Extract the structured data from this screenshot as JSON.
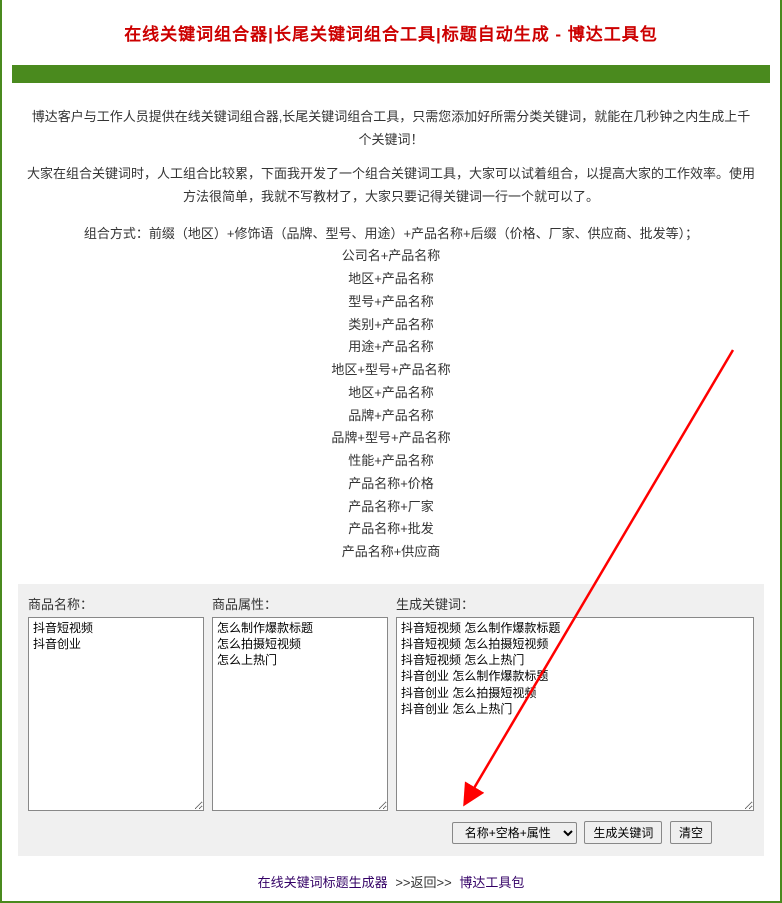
{
  "title": "在线关键词组合器|长尾关键词组合工具|标题自动生成 - 博达工具包",
  "intro": {
    "p1": "博达客户与工作人员提供在线关键词组合器,长尾关键词组合工具，只需您添加好所需分类关键词，就能在几秒钟之内生成上千个关键词！",
    "p2": "大家在组合关键词时，人工组合比较累，下面我开发了一个组合关键词工具，大家可以试着组合，以提高大家的工作效率。使用方法很简单，我就不写教材了，大家只要记得关键词一行一个就可以了。"
  },
  "combo": {
    "head": "组合方式：前缀（地区）+修饰语（品牌、型号、用途）+产品名称+后缀（价格、厂家、供应商、批发等）；",
    "items": [
      "公司名+产品名称",
      "地区+产品名称",
      "型号+产品名称",
      "类别+产品名称",
      "用途+产品名称",
      "地区+型号+产品名称",
      "地区+产品名称",
      "品牌+产品名称",
      "品牌+型号+产品名称",
      "性能+产品名称",
      "产品名称+价格",
      "产品名称+厂家",
      "产品名称+批发",
      "产品名称+供应商"
    ]
  },
  "form": {
    "label_name": "商品名称：",
    "label_attr": "商品属性：",
    "label_result": "生成关键词：",
    "name_value": "抖音短视频\n抖音创业",
    "attr_value": "怎么制作爆款标题\n怎么拍摄短视频\n怎么上热门",
    "result_value": "抖音短视频 怎么制作爆款标题\n抖音短视频 怎么拍摄短视频\n抖音短视频 怎么上热门\n抖音创业 怎么制作爆款标题\n抖音创业 怎么拍摄短视频\n抖音创业 怎么上热门",
    "select_option": "名称+空格+属性",
    "btn_generate": "生成关键词",
    "btn_clear": "清空"
  },
  "footer": {
    "link1": "在线关键词标题生成器",
    "sep": ">>返回>>",
    "link2": "博达工具包"
  }
}
